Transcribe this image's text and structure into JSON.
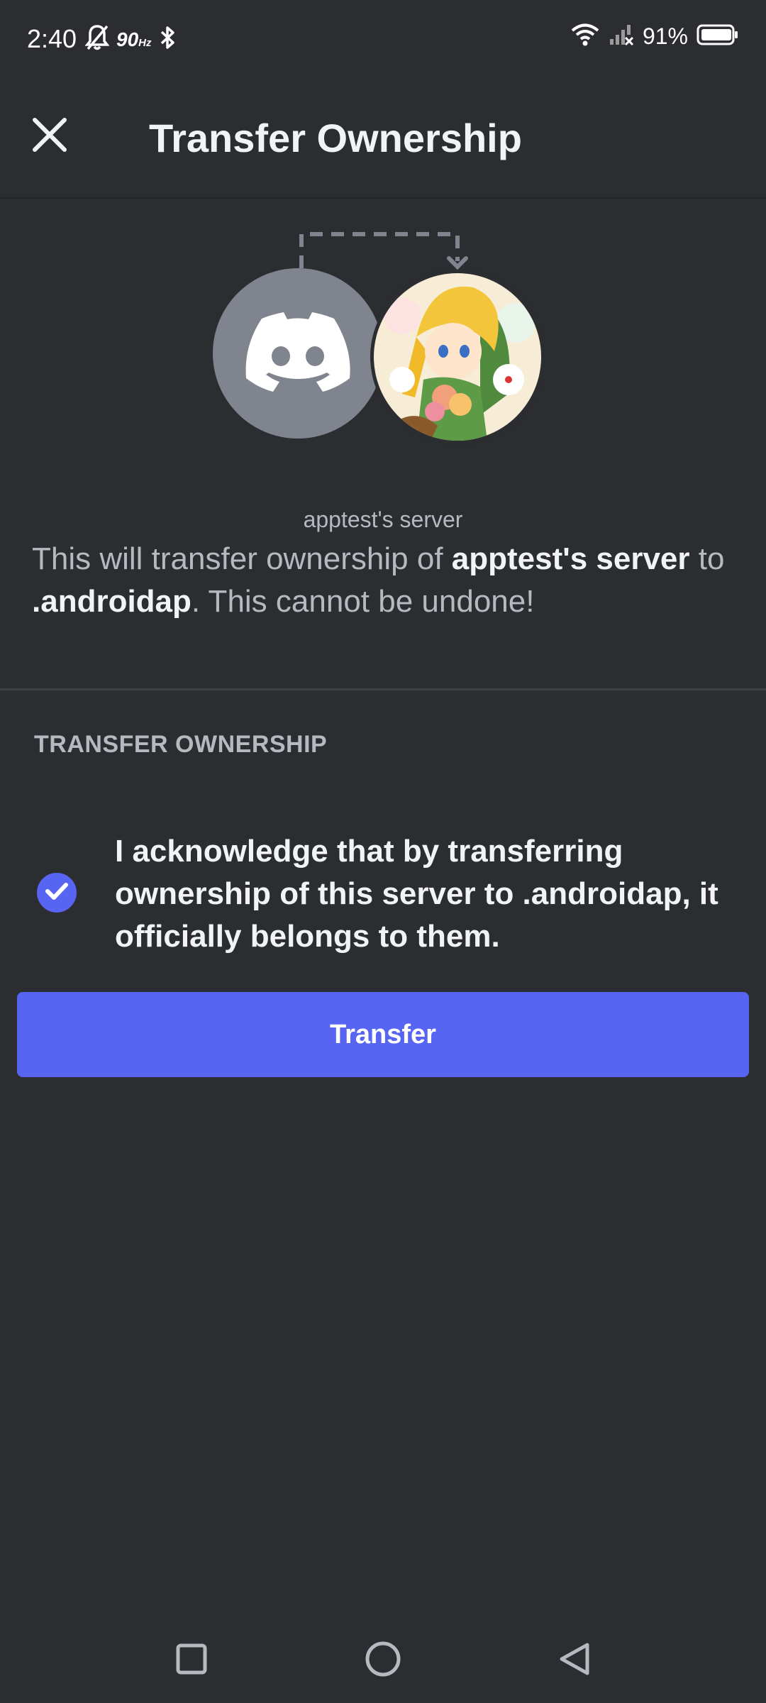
{
  "status_bar": {
    "time": "2:40",
    "refresh_rate": "90",
    "refresh_unit": "Hz",
    "battery_percent": "91%",
    "icons": [
      "mute-bell-icon",
      "bluetooth-icon",
      "wifi-icon",
      "signal-icon",
      "battery-icon"
    ]
  },
  "header": {
    "title": "Transfer Ownership",
    "close_icon": "close-icon"
  },
  "transfer": {
    "server_name": "apptest's server",
    "description_prefix": "This will transfer ownership of ",
    "description_server": "apptest's server",
    "description_mid": " to ",
    "description_user": ".androidap",
    "description_suffix": ". This cannot be undone!"
  },
  "section": {
    "header": "TRANSFER OWNERSHIP"
  },
  "acknowledge": {
    "checked": true,
    "text": "I acknowledge that by transferring ownership of this server to .androidap, it officially belongs to them."
  },
  "actions": {
    "transfer_label": "Transfer"
  },
  "colors": {
    "background": "#2b2d31",
    "accent": "#5865f2",
    "muted_text": "#b5bac1"
  },
  "nav_bar": {
    "icons": [
      "recents-square-icon",
      "home-circle-icon",
      "back-triangle-icon"
    ]
  }
}
